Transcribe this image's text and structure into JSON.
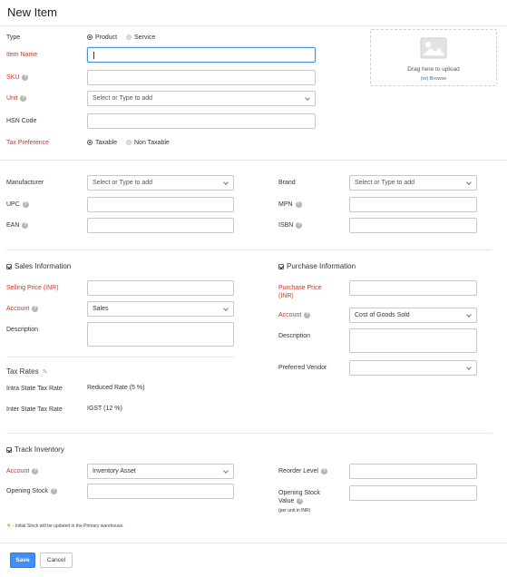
{
  "page": {
    "title": "New Item"
  },
  "type": {
    "label": "Type",
    "options": [
      "Product",
      "Service"
    ],
    "selected": "Product"
  },
  "item_name": {
    "label": "Item Name",
    "value": ""
  },
  "sku": {
    "label": "SKU",
    "value": ""
  },
  "unit": {
    "label": "Unit",
    "placeholder": "Select or Type to add"
  },
  "hsn": {
    "label": "HSN Code",
    "value": ""
  },
  "tax_pref": {
    "label": "Tax Preference",
    "options": [
      "Taxable",
      "Non Taxable"
    ],
    "selected": "Taxable"
  },
  "upload": {
    "text": "Drag here to upload",
    "link": "(or) Browse"
  },
  "manufacturer": {
    "label": "Manufacturer",
    "placeholder": "Select or Type to add"
  },
  "brand": {
    "label": "Brand",
    "placeholder": "Select or Type to add"
  },
  "upc": {
    "label": "UPC"
  },
  "mpn": {
    "label": "MPN"
  },
  "ean": {
    "label": "EAN"
  },
  "isbn": {
    "label": "ISBN"
  },
  "sales": {
    "heading": "Sales Information",
    "price_label": "Selling Price (INR)",
    "account_label": "Account",
    "account_value": "Sales",
    "description_label": "Description"
  },
  "purchase": {
    "heading": "Purchase Information",
    "price_label_1": "Purchase Price",
    "price_label_2": "(INR)",
    "account_label": "Account",
    "account_value": "Cost of Goods Sold",
    "description_label": "Description",
    "vendor_label": "Preferred Vendor",
    "vendor_value": ""
  },
  "tax_rates": {
    "heading": "Tax Rates",
    "intra_label": "Intra State Tax Rate",
    "intra_value": "Reduced Rate (5 %)",
    "inter_label": "Inter State Tax Rate",
    "inter_value": "IGST (12 %)"
  },
  "inventory": {
    "heading": "Track Inventory",
    "account_label": "Account",
    "account_value": "Inventory Asset",
    "opening_stock_label": "Opening Stock",
    "reorder_label": "Reorder Level",
    "opening_value_label_1": "Opening Stock",
    "opening_value_label_2": "Value",
    "opening_value_sub": "(per unit in INR)",
    "note": "- Initial Stock will be updated in the Primary warehouse."
  },
  "actions": {
    "save": "Save",
    "cancel": "Cancel"
  },
  "colors": {
    "required": "#c0392b",
    "primary": "#408dfb",
    "link": "#2a6ebb"
  },
  "icons": [
    "help-icon",
    "chevron-down-icon",
    "image-icon",
    "pencil-icon",
    "star-icon",
    "checkbox-icon"
  ]
}
